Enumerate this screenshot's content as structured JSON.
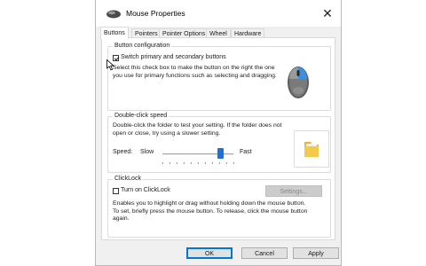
{
  "window": {
    "title": "Mouse Properties",
    "close_glyph": "✕"
  },
  "tabs": [
    {
      "label": "Buttons",
      "active": true
    },
    {
      "label": "Pointers",
      "active": false
    },
    {
      "label": "Pointer Options",
      "active": false
    },
    {
      "label": "Wheel",
      "active": false
    },
    {
      "label": "Hardware",
      "active": false
    }
  ],
  "button_config": {
    "title": "Button configuration",
    "checkbox_label": "Switch primary and secondary buttons",
    "checked": true,
    "description": "Select this check box to make the button on the right the one you use for primary functions such as selecting and dragging.",
    "preview_icon": "mouse-icon"
  },
  "double_click": {
    "title": "Double-click speed",
    "description": "Double-click the folder to test your setting. If the folder does not open or close, try using a slower setting.",
    "speed_label": "Speed:",
    "slow_label": "Slow",
    "fast_label": "Fast",
    "speed_fraction": 0.82,
    "preview_icon": "folder-icon"
  },
  "clicklock": {
    "title": "ClickLock",
    "checkbox_label": "Turn on ClickLock",
    "checked": false,
    "settings_label": "Settings...",
    "description": "Enables you to highlight or drag without holding down the mouse button. To set, briefly press the mouse button. To release, click the mouse button again."
  },
  "footer": {
    "ok": "OK",
    "cancel": "Cancel",
    "apply": "Apply"
  },
  "colors": {
    "accent": "#0078d7",
    "slider_thumb": "#1e6fd9",
    "mouse_highlight": "#3d8fe0",
    "folder_yellow": "#f3c94c"
  }
}
